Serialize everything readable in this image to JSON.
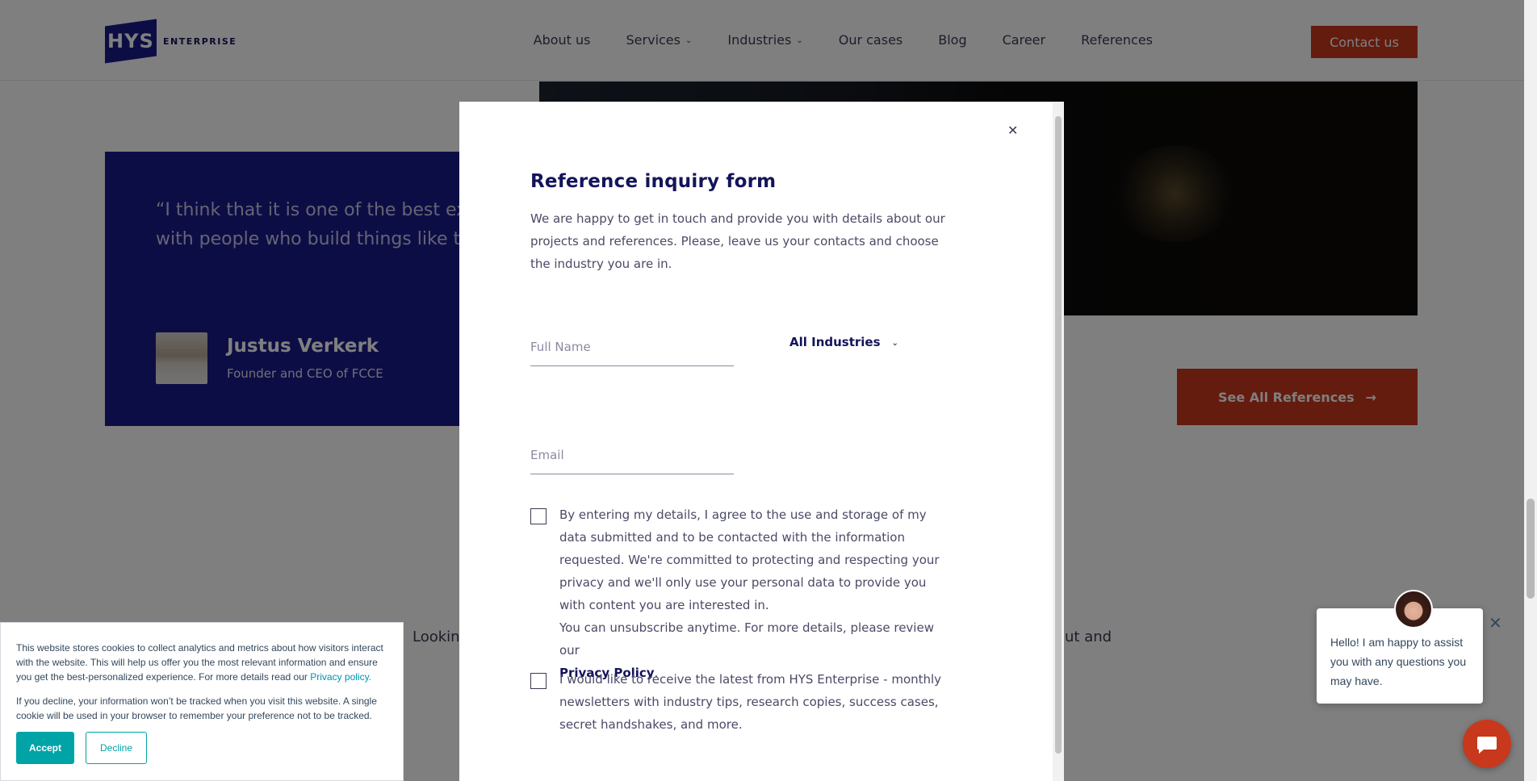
{
  "header": {
    "logo_text": "HYS",
    "logo_word": "ENTERPRISE",
    "nav": {
      "about": "About us",
      "services": "Services",
      "industries": "Industries",
      "cases": "Our cases",
      "blog": "Blog",
      "career": "Career",
      "references": "References"
    },
    "contact": "Contact us"
  },
  "testimonial": {
    "quote": "“I think that it is one of the best ex\nwith people who build things like t",
    "name": "Justus Verkerk",
    "role": "Founder and CEO of FCCE"
  },
  "see_refs": "See All References",
  "body_text_left": "Lookin",
  "body_text_right": "out and",
  "modal": {
    "title": "Reference inquiry form",
    "description": "We are happy to get in touch and provide you with details about our projects and references. Please, leave us your contacts and choose the industry you are in.",
    "fullname_placeholder": "Full Name",
    "email_placeholder": "Email",
    "industry_selected": "All Industries",
    "consent_text": "By entering my details, I agree to the use and storage of my data submitted and to be contacted with the information requested. We're committed to protecting and respecting your privacy and we'll only use your personal data to provide you with content you are interested in.",
    "unsubscribe_text": "You can unsubscribe anytime. For more details, please review our",
    "privacy_link": "Privacy Policy",
    "newsletter_text": "I would like to receive the latest from HYS Enterprise - monthly newsletters with industry tips, research copies, success cases, secret handshakes, and more."
  },
  "cookie": {
    "p1": "This website stores cookies to collect analytics and metrics about how visitors interact with the website. This will help us offer you the most relevant information and ensure you get the best-personalized experience. For more details read our",
    "p1_link": "Privacy policy.",
    "p2": "If you decline, your information won’t be tracked when you visit this website. A single cookie will be used in your browser to remember your preference not to be tracked.",
    "accept": "Accept",
    "decline": "Decline"
  },
  "chat": {
    "message": "Hello! I am happy to assist you with any questions you may have."
  },
  "colors": {
    "brand_navy": "#1a1a8c",
    "accent_red": "#c8381c",
    "cookie_teal": "#00a4a6"
  },
  "icons": [
    "close-icon",
    "chevron-down-icon",
    "arrow-right-icon",
    "chat-icon"
  ]
}
